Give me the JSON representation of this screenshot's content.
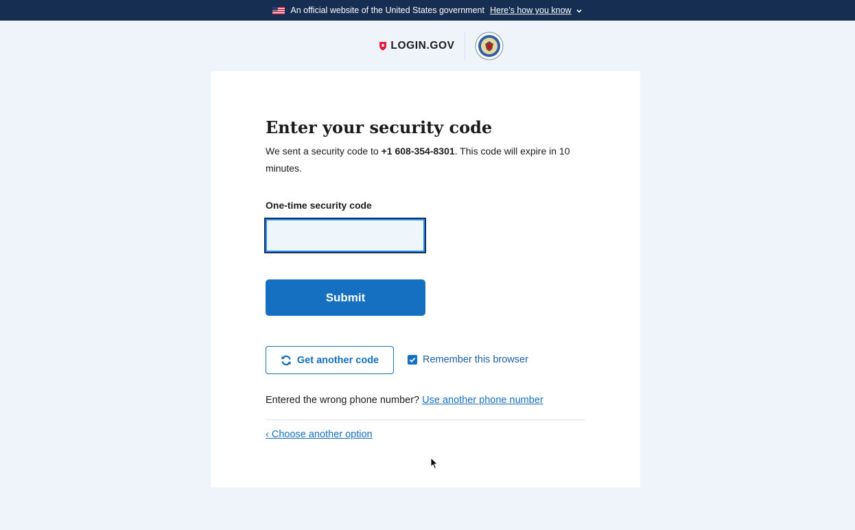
{
  "banner": {
    "text": "An official website of the United States government",
    "link": "Here’s how you know"
  },
  "header": {
    "logo_text": "LOGIN.GOV",
    "seal_icon": "agency-seal-icon"
  },
  "main": {
    "title": "Enter your security code",
    "intro_prefix": "We sent a security code to ",
    "phone": "+1 608-354-8301",
    "intro_suffix": ". This code will expire in 10 minutes.",
    "field_label": "One-time security code",
    "input_value": "",
    "submit_label": "Submit",
    "resend_label": "Get another code",
    "remember_label": "Remember this browser",
    "remember_checked": true,
    "wrong_number_text": "Entered the wrong phone number?",
    "wrong_number_link": "Use another phone number",
    "choose_option_link": "‹ Choose another option"
  },
  "colors": {
    "banner_bg": "#162e51",
    "page_bg": "#eef4f9",
    "primary": "#1670c2",
    "brand_red": "#e21c3d"
  }
}
